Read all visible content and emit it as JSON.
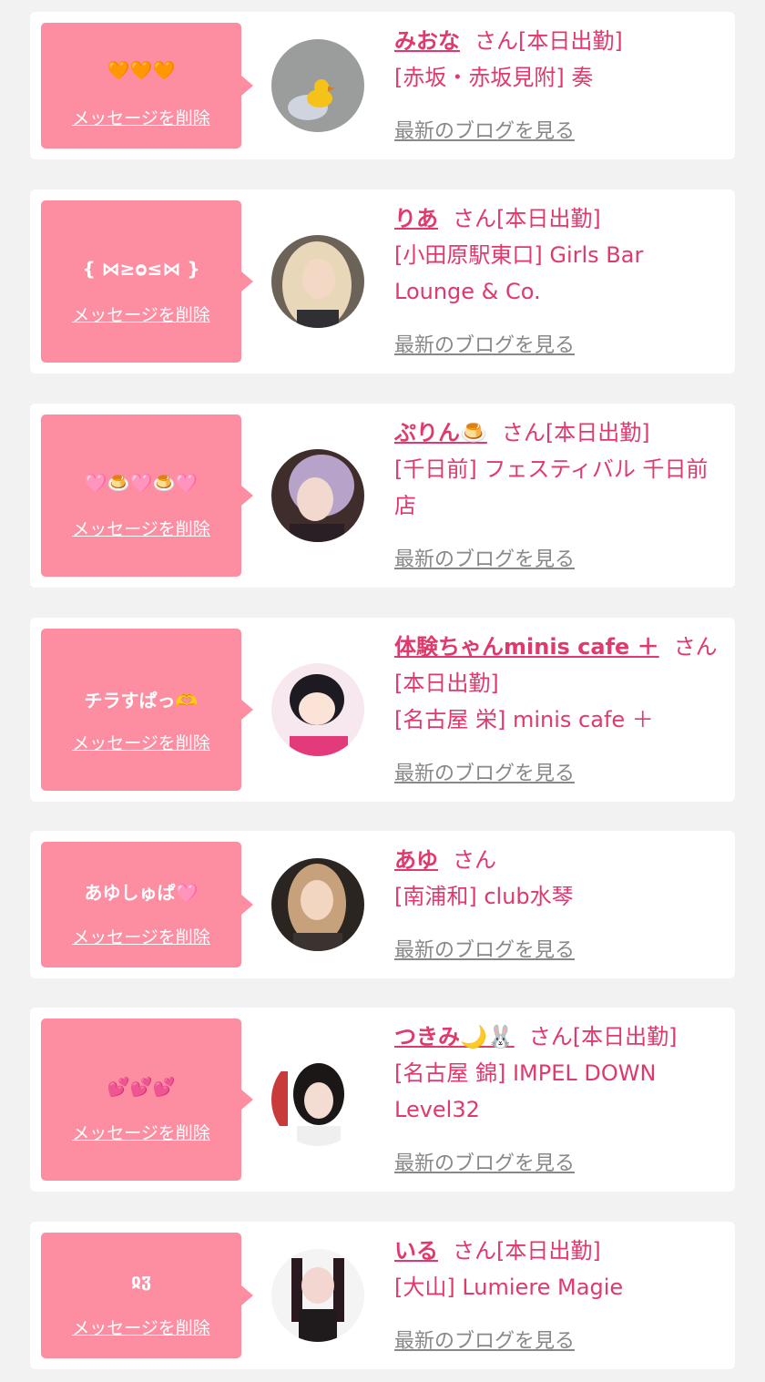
{
  "delete_label": "メッセージを削除",
  "blog_label": "最新のブログを見る",
  "san_label": "さん",
  "attendance_label": "[本日出勤]",
  "colors": {
    "accent": "#e0396b",
    "message_bg": "#fd8ea2",
    "card_bg": "#ffffff",
    "page_bg": "#f2f2f2",
    "blog_link": "#888888"
  },
  "cards": [
    {
      "message": "🧡🧡🧡",
      "name": "みおな",
      "suffix": "さん[本日出勤]",
      "shop": "[赤坂・赤坂見附] 奏",
      "avatar_icon": "duck-photo"
    },
    {
      "message": "{ ⋈≥ᴑ≤⋈ }",
      "name": "りあ",
      "suffix": "さん[本日出勤]",
      "shop": "[小田原駅東口] Girls Bar Lounge & Co.",
      "avatar_icon": "profile-photo"
    },
    {
      "message": "🩷🍮🩷🍮🩷",
      "name": "ぷりん🍮",
      "suffix": "さん[本日出勤]",
      "shop": "[千日前] フェスティバル 千日前店",
      "avatar_icon": "profile-photo"
    },
    {
      "message": "チラすぱっ🫶",
      "name": "体験ちゃんminis cafe ＋",
      "suffix": "さん[本日出勤]",
      "shop": "[名古屋 栄] minis cafe ＋",
      "avatar_icon": "illustration-photo"
    },
    {
      "message": "あゆしゅぱ🩷",
      "name": "あゆ",
      "suffix": "さん",
      "shop": "[南浦和] club水琴",
      "avatar_icon": "profile-photo"
    },
    {
      "message": "💕💕💕",
      "name": "つきみ🌙🐰",
      "suffix": "さん[本日出勤]",
      "shop": "[名古屋 錦] IMPEL DOWN Level32",
      "avatar_icon": "profile-photo"
    },
    {
      "message": "ჲჳ",
      "name": "いる",
      "suffix": "さん[本日出勤]",
      "shop": "[大山] Lumiere Magie",
      "avatar_icon": "profile-photo"
    }
  ]
}
